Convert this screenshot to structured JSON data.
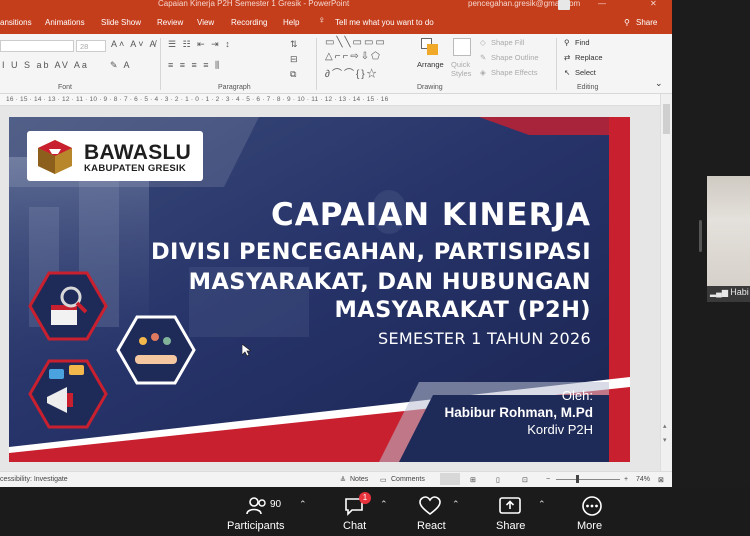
{
  "window": {
    "title_left": "Capaian Kinerja P2H Semester 1 Gresik  -  PowerPoint",
    "title_right": "pencegahan.gresik@gmail.com",
    "search_hint": "Tell me what you want to do",
    "share_label": "Share"
  },
  "ribbon_tabs": [
    "ansitions",
    "Animations",
    "Slide Show",
    "Review",
    "View",
    "Recording",
    "Help"
  ],
  "ribbon": {
    "font_size": "28",
    "font_label": "Font",
    "paragraph_label": "Paragraph",
    "drawing_label": "Drawing",
    "editing_label": "Editing",
    "arrange_label": "Arrange",
    "quick_styles_label": "Quick Styles",
    "shape_fill": "Shape Fill",
    "shape_outline": "Shape Outline",
    "shape_effects": "Shape Effects",
    "find": "Find",
    "replace": "Replace",
    "select": "Select"
  },
  "ruler_text": "16 · 15 · 14 · 13 · 12 · 11 · 10 · 9 · 8 · 7 · 6 · 5 · 4 · 3 · 2 · 1 · 0 · 1 · 2 · 3 · 4 · 5 · 6 · 7 · 8 · 9 · 10 · 11 · 12 · 13 · 14 · 15 · 16",
  "slide": {
    "logo_main": "BAWASLU",
    "logo_sub": "KABUPATEN GRESIK",
    "title": "CAPAIAN KINERJA",
    "line1": "DIVISI PENCEGAHAN, PARTISIPASI",
    "line2": "MASYARAKAT, DAN HUBUNGAN",
    "line3": "MASYARAKAT (P2H)",
    "semester": "SEMESTER 1 TAHUN 2026",
    "oleh": "Oleh:",
    "presenter": "Habibur Rohman, M.Pd",
    "role": "Kordiv P2H"
  },
  "statusbar": {
    "accessibility": "cessibility: Investigate",
    "notes": "Notes",
    "comments": "Comments",
    "zoom": "74%"
  },
  "video": {
    "name": "Habi"
  },
  "meeting": {
    "participants_count": "90",
    "participants_label": "Participants",
    "chat_label": "Chat",
    "chat_badge": "1",
    "react_label": "React",
    "share_label": "Share",
    "more_label": "More"
  },
  "colors": {
    "ppt_accent": "#c43e1c",
    "slide_navy": "#1e2a58",
    "slide_red": "#c8202f"
  }
}
